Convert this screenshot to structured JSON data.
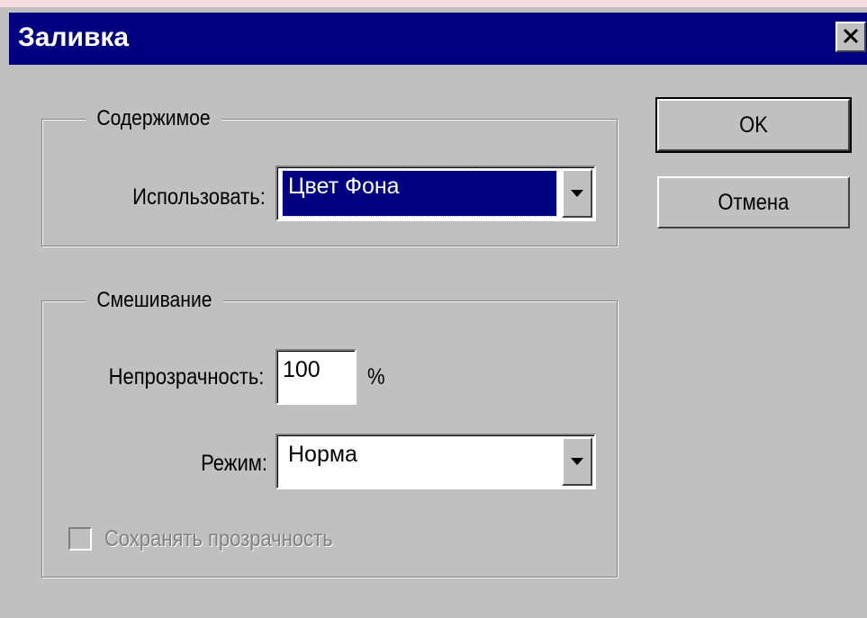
{
  "window": {
    "title": "Заливка",
    "close_glyph": "✕"
  },
  "content_group": {
    "legend": "Содержимое",
    "use_label": "Использовать:",
    "use_value": "Цвет Фона"
  },
  "blending_group": {
    "legend": "Смешивание",
    "opacity_label": "Непрозрачность:",
    "opacity_value": "100",
    "opacity_unit": "%",
    "mode_label": "Режим:",
    "mode_value": "Норма",
    "preserve_transparency_label": "Сохранять прозрачность",
    "preserve_transparency_checked": false
  },
  "buttons": {
    "ok_label": "OK",
    "cancel_label": "Отмена"
  },
  "colors": {
    "titlebar": "#000080",
    "dialog_bg": "#c0c0c0",
    "page_bg": "#f7dede"
  }
}
